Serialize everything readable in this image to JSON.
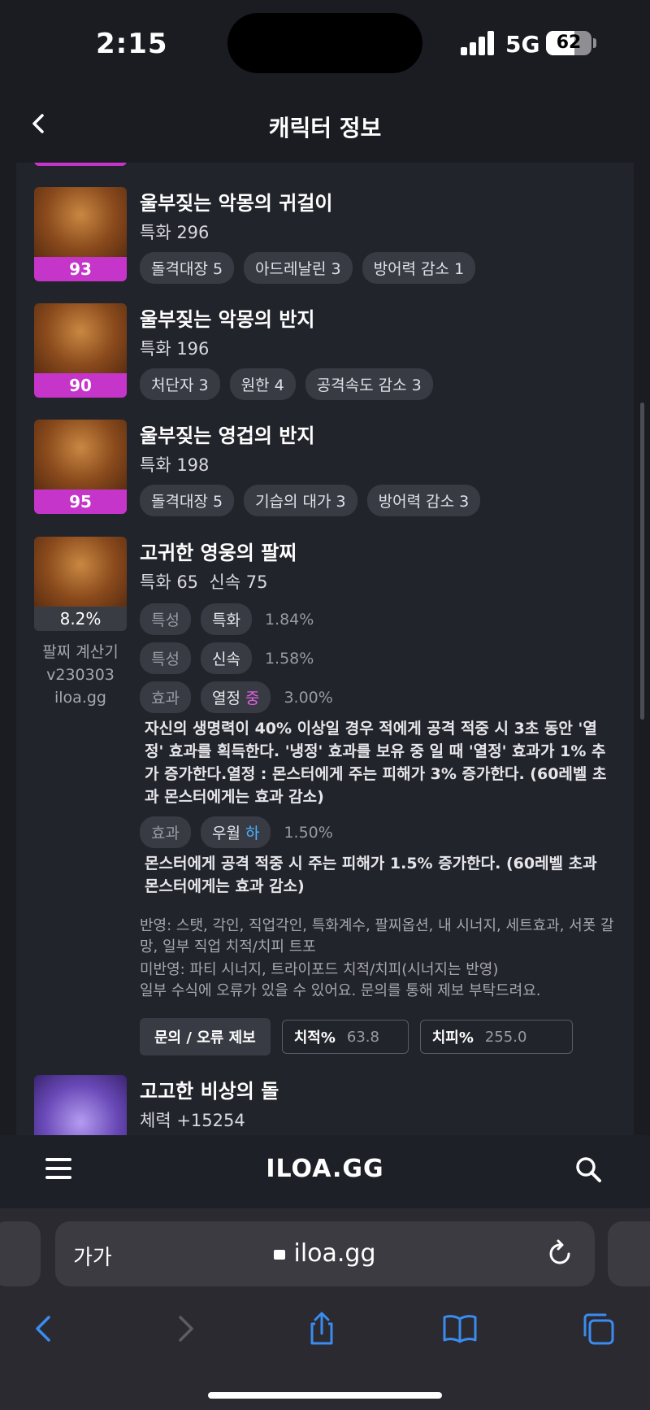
{
  "status_bar": {
    "time": "2:15",
    "network": "5G",
    "battery": 62
  },
  "header": {
    "title": "캐릭터 정보"
  },
  "items": [
    {
      "name": "울부짖는 악몽의 귀걸이",
      "stat": "특화 296",
      "level": "93",
      "tags": [
        "돌격대장 5",
        "아드레날린 3",
        "방어력 감소 1"
      ]
    },
    {
      "name": "울부짖는 악몽의 반지",
      "stat": "특화 196",
      "level": "90",
      "tags": [
        "처단자 3",
        "원한 4",
        "공격속도 감소 3"
      ]
    },
    {
      "name": "울부짖는 영겁의 반지",
      "stat": "특화 198",
      "level": "95",
      "tags": [
        "돌격대장 5",
        "기습의 대가 3",
        "방어력 감소 3"
      ]
    }
  ],
  "bracelet": {
    "name": "고귀한 영웅의 팔찌",
    "stats": "특화 65  신속 75",
    "pct": "8.2%",
    "side_lines": [
      "팔찌 계산기",
      "v230303",
      "iloa.gg"
    ],
    "rows": [
      {
        "key": "특성",
        "val": "특화",
        "grade": "",
        "pct": "1.84%"
      },
      {
        "key": "특성",
        "val": "신속",
        "grade": "",
        "pct": "1.58%"
      },
      {
        "key": "효과",
        "val": "열정",
        "grade": "중",
        "grade_color": "#e060e0",
        "pct": "3.00%"
      },
      {
        "key": "효과",
        "val": "우월",
        "grade": "하",
        "grade_color": "#4ab2ff",
        "pct": "1.50%"
      }
    ],
    "desc1": "자신의 생명력이 40% 이상일 경우 적에게 공격 적중 시 3초 동안 '열정' 효과를 획득한다. '냉정' 효과를 보유 중 일 때 '열정' 효과가 1% 추가 증가한다.열정 : 몬스터에게 주는 피해가 3% 증가한다. (60레벨 초과 몬스터에게는 효과 감소)",
    "desc2": "몬스터에게 공격 적중 시 주는 피해가 1.5% 증가한다. (60레벨 초과 몬스터에게는 효과 감소)",
    "note1": "반영: 스탯, 각인, 직업각인, 특화계수, 팔찌옵션, 내 시너지, 세트효과, 서폿 갈망, 일부 직업 치적/치피 트포",
    "note2": "미반영: 파티 시너지, 트라이포드 치적/치피(시너지는 반영)",
    "note3": "일부 수식에 오류가 있을 수 있어요. 문의를 통해 제보 부탁드려요.",
    "report_button": "문의 / 오류 제보",
    "crit_label": "치적%",
    "crit_value": "63.8",
    "critdmg_label": "치피%",
    "critdmg_value": "255.0"
  },
  "stone": {
    "name": "고고한 비상의 돌",
    "stat": "체력 +15254"
  },
  "site": {
    "logo": "ILOA.GG"
  },
  "browser": {
    "text_size": "가가",
    "url": "iloa.gg"
  },
  "colors": {
    "level_bg": "#c535c9",
    "card_bg": "#22242b",
    "chip_bg": "#393b44",
    "link_blue": "#3b8cf0"
  }
}
